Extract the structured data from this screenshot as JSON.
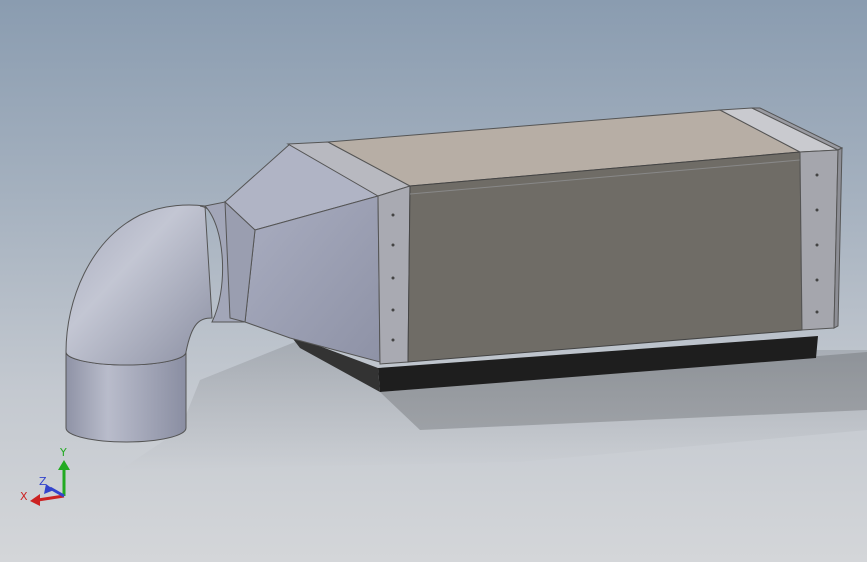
{
  "triad": {
    "y_label": "Y",
    "z_label": "Z",
    "x_label": "X",
    "y_color": "#22aa22",
    "z_color": "#3344cc",
    "x_color": "#cc2222"
  },
  "model": {
    "duct_color": "#9fa3b6",
    "panel_color": "#6f6c66",
    "top_color": "#b5aca3",
    "base_color": "#2a2a2a"
  }
}
